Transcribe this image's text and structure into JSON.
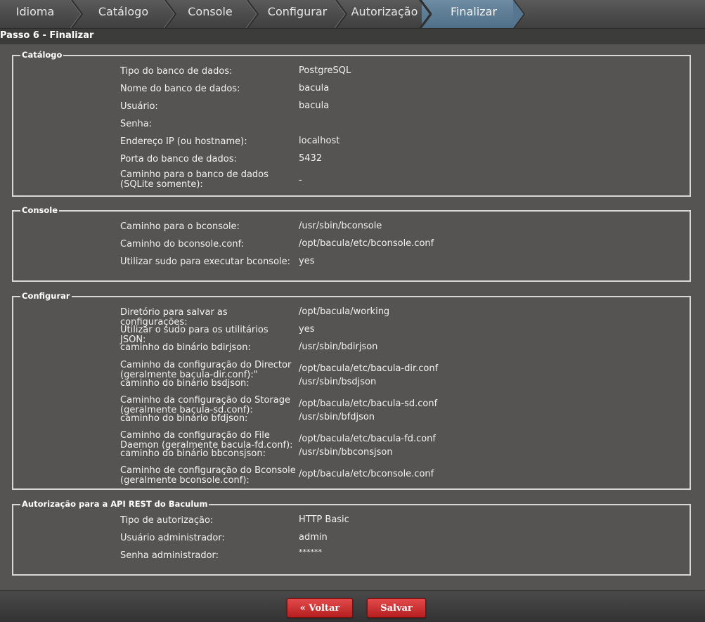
{
  "steps": [
    "Idioma",
    "Catálogo",
    "Console",
    "Configurar",
    "Autorização",
    "Finalizar"
  ],
  "active_step": "Finalizar",
  "page_title": "Passo 6 - Finalizar",
  "catalog": {
    "legend": "Catálogo",
    "rows": [
      {
        "label": "Tipo do banco de dados:",
        "value": "PostgreSQL"
      },
      {
        "label": "Nome do banco de dados:",
        "value": "bacula"
      },
      {
        "label": "Usuário:",
        "value": "bacula"
      },
      {
        "label": "Senha:",
        "value": ""
      },
      {
        "label": "Endereço IP (ou hostname):",
        "value": "localhost"
      },
      {
        "label": "Porta do banco de dados:",
        "value": "5432"
      },
      {
        "label": "Caminho para o banco de dados (SQLite somente):",
        "value": "-"
      }
    ]
  },
  "console": {
    "legend": "Console",
    "rows": [
      {
        "label": "Caminho para o bconsole:",
        "value": "/usr/sbin/bconsole"
      },
      {
        "label": "Caminho do bconsole.conf:",
        "value": "/opt/bacula/etc/bconsole.conf"
      },
      {
        "label": "Utilizar sudo para executar bconsole:",
        "value": "yes"
      }
    ]
  },
  "config": {
    "legend": "Configurar",
    "rows": [
      {
        "label": "Diretório para salvar as configurações:",
        "value": "/opt/bacula/working"
      },
      {
        "label": "Utilizar o sudo para os utilitários JSON:",
        "value": "yes"
      },
      {
        "label": "caminho do binário bdirjson:",
        "value": "/usr/sbin/bdirjson"
      },
      {
        "label": "Caminho da configuração do Director (geralmente bacula-dir.conf):\"",
        "value": "/opt/bacula/etc/bacula-dir.conf"
      },
      {
        "label": "caminho do binário bsdjson:",
        "value": "/usr/sbin/bsdjson"
      },
      {
        "label": "Caminho da configuração do Storage (geralmente bacula-sd.conf):",
        "value": "/opt/bacula/etc/bacula-sd.conf"
      },
      {
        "label": "caminho do binário bfdjson:",
        "value": "/usr/sbin/bfdjson"
      },
      {
        "label": "Caminho da configuração do File Daemon (geralmente bacula-fd.conf):",
        "value": "/opt/bacula/etc/bacula-fd.conf"
      },
      {
        "label": "caminho do binário bbconsjson:",
        "value": "/usr/sbin/bbconsjson"
      },
      {
        "label": "Caminho de configuração do Bconsole (geralmente bconsole.conf):",
        "value": "/opt/bacula/etc/bconsole.conf"
      }
    ]
  },
  "auth": {
    "legend": "Autorização para a API REST do Baculum",
    "rows": [
      {
        "label": "Tipo de autorização:",
        "value": "HTTP Basic"
      },
      {
        "label": "Usuário administrador:",
        "value": "admin"
      },
      {
        "label": "Senha administrador:",
        "value": "******"
      }
    ]
  },
  "buttons": {
    "back": "« Voltar",
    "save": "Salvar"
  },
  "colors": {
    "accent_step": "#5e7e98",
    "button_red": "#c93030"
  }
}
